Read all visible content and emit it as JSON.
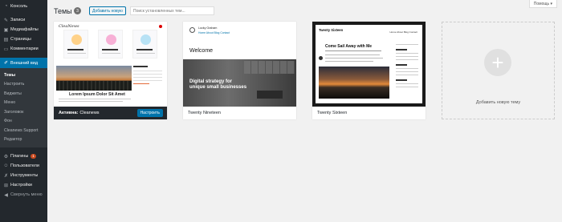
{
  "sidebar": {
    "items": [
      {
        "label": "Консоль",
        "icon": "dashboard-icon"
      },
      {
        "label": "Записи",
        "icon": "pin-icon"
      },
      {
        "label": "Медиафайлы",
        "icon": "media-icon"
      },
      {
        "label": "Страницы",
        "icon": "page-icon"
      },
      {
        "label": "Комментарии",
        "icon": "comment-icon"
      },
      {
        "label": "Внешний вид",
        "icon": "brush-icon"
      },
      {
        "label": "Плагины",
        "icon": "plugin-icon",
        "badge": "1"
      },
      {
        "label": "Пользователи",
        "icon": "users-icon"
      },
      {
        "label": "Инструменты",
        "icon": "wrench-icon"
      },
      {
        "label": "Настройки",
        "icon": "settings-icon"
      },
      {
        "label": "Свернуть меню",
        "icon": "collapse-icon"
      }
    ],
    "submenu": [
      "Темы",
      "Настроить",
      "Виджеты",
      "Меню",
      "Заголовок",
      "Фон",
      "Cleanews Support",
      "Редактор"
    ]
  },
  "header": {
    "title": "Темы",
    "count": "3",
    "add_button": "Добавить новую",
    "search_placeholder": "Поиск установленных тем...",
    "help": "Помощь ▾"
  },
  "themes": [
    {
      "name": "Cleanews",
      "active_prefix": "Активна:",
      "customize": "Настроить",
      "preview": {
        "logo": "CleaNews",
        "heading": "Lorem Ipsum Dolor Sit Amet"
      }
    },
    {
      "name": "Twenty Nineteen",
      "preview": {
        "site": "Lucky Graham",
        "nav": "Home  About  Blog  Contact",
        "welcome": "Welcome",
        "hero_line1": "Digital strategy for",
        "hero_line2": "unique small businesses"
      }
    },
    {
      "name": "Twenty Sixteen",
      "preview": {
        "title": "Twenty Sixteen",
        "nav": "Home  About  Blog  Contact",
        "post": "Come Sail Away with Me"
      }
    }
  ],
  "add_new": {
    "label": "Добавить новую тему",
    "icon": "plus-icon"
  }
}
